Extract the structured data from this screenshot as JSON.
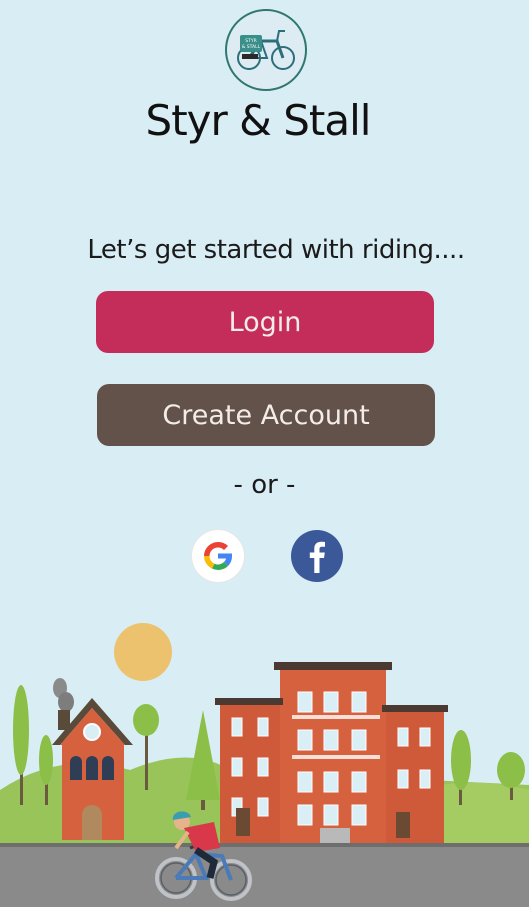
{
  "app": {
    "title": "Styr & Stall",
    "logo_text_line1": "STYR",
    "logo_text_line2": "& STALL",
    "tagline": "Let’s get started with riding...."
  },
  "auth": {
    "login_label": "Login",
    "create_account_label": "Create Account",
    "or_separator": "- or -"
  },
  "social": {
    "google_icon": "google-icon",
    "facebook_icon": "facebook-icon"
  },
  "colors": {
    "background": "#d9edf5",
    "login_button": "#c42c5a",
    "create_button": "#62524a",
    "facebook": "#3b5998",
    "logo_ring": "#2f7770"
  }
}
